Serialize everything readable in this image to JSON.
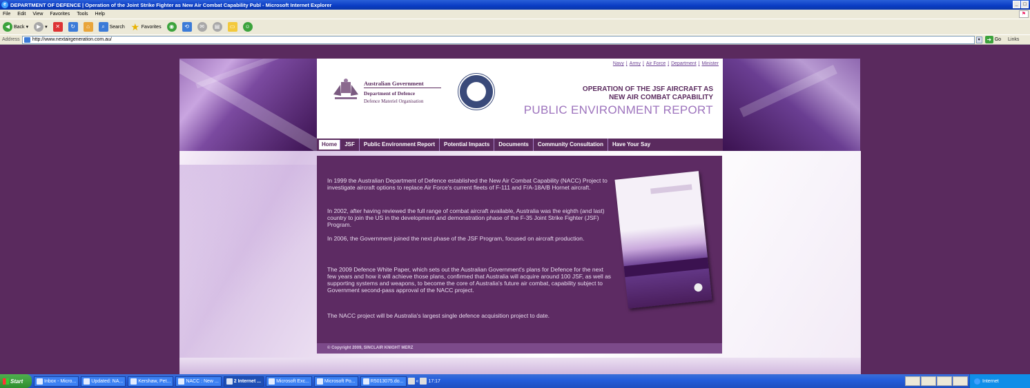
{
  "window": {
    "title": "DEPARTMENT OF DEFENCE | Operation of the Joint Strike Fighter as New Air Combat Capability Publ - Microsoft Internet Explorer",
    "controls": [
      "_",
      "□"
    ]
  },
  "menu": [
    "File",
    "Edit",
    "View",
    "Favorites",
    "Tools",
    "Help"
  ],
  "toolbar": {
    "back": "Back",
    "search": "Search",
    "favorites": "Favorites"
  },
  "address": {
    "label": "Address",
    "url": "http://www.nextairgeneration.com.au/",
    "go": "Go",
    "links": "Links"
  },
  "site": {
    "toplinks": [
      "Navy",
      "Army",
      "Air Force",
      "Department",
      "Minister"
    ],
    "govt": {
      "line1": "Australian Government",
      "line2": "Department of Defence",
      "line3": "Defence Materiel Organisation"
    },
    "title_line1": "OPERATION OF THE JSF AIRCRAFT AS",
    "title_line2": "NEW AIR COMBAT CAPABILITY",
    "report": "PUBLIC ENVIRONMENT REPORT",
    "nav": [
      "Home",
      "JSF",
      "Public Environment Report",
      "Potential Impacts",
      "Documents",
      "Community Consultation",
      "Have Your Say"
    ],
    "paragraphs": [
      "In 1999 the Australian Department of Defence established the New Air Combat Capability (NACC) Project to investigate aircraft options to replace Air Force's current fleets of F-111 and F/A-18A/B Hornet aircraft.",
      "In 2002, after having reviewed the full range of combat aircraft available, Australia was the eighth (and last) country to join the US in the development and demonstration phase of the F-35 Joint Strike Fighter (JSF) Program.",
      "In 2006, the Government joined the next phase of the JSF Program, focused on aircraft production.",
      "The 2009 Defence White Paper, which sets out the Australian Government's plans for Defence for the next few years and how it will achieve those plans, confirmed that Australia will acquire around 100 JSF, as well as supporting systems and weapons, to become the core of Australia's future air combat, capability subject to Government second-pass approval of the NACC project.",
      "The NACC project will be Australia's largest single defence acquisition project to date."
    ],
    "copyright": "© Copyright 2009, SINCLAIR KNIGHT MERZ"
  },
  "taskbar": {
    "start": "Start",
    "tasks": [
      "Inbox - Micro...",
      "Updated: NA...",
      "Kershaw, Pet...",
      "NACC : New ...",
      "2 Internet ...",
      "Microsoft Exc...",
      "Microsoft Po...",
      "R5013075.do..."
    ],
    "quick": "«",
    "clock": "17:17",
    "zone": "Internet"
  }
}
